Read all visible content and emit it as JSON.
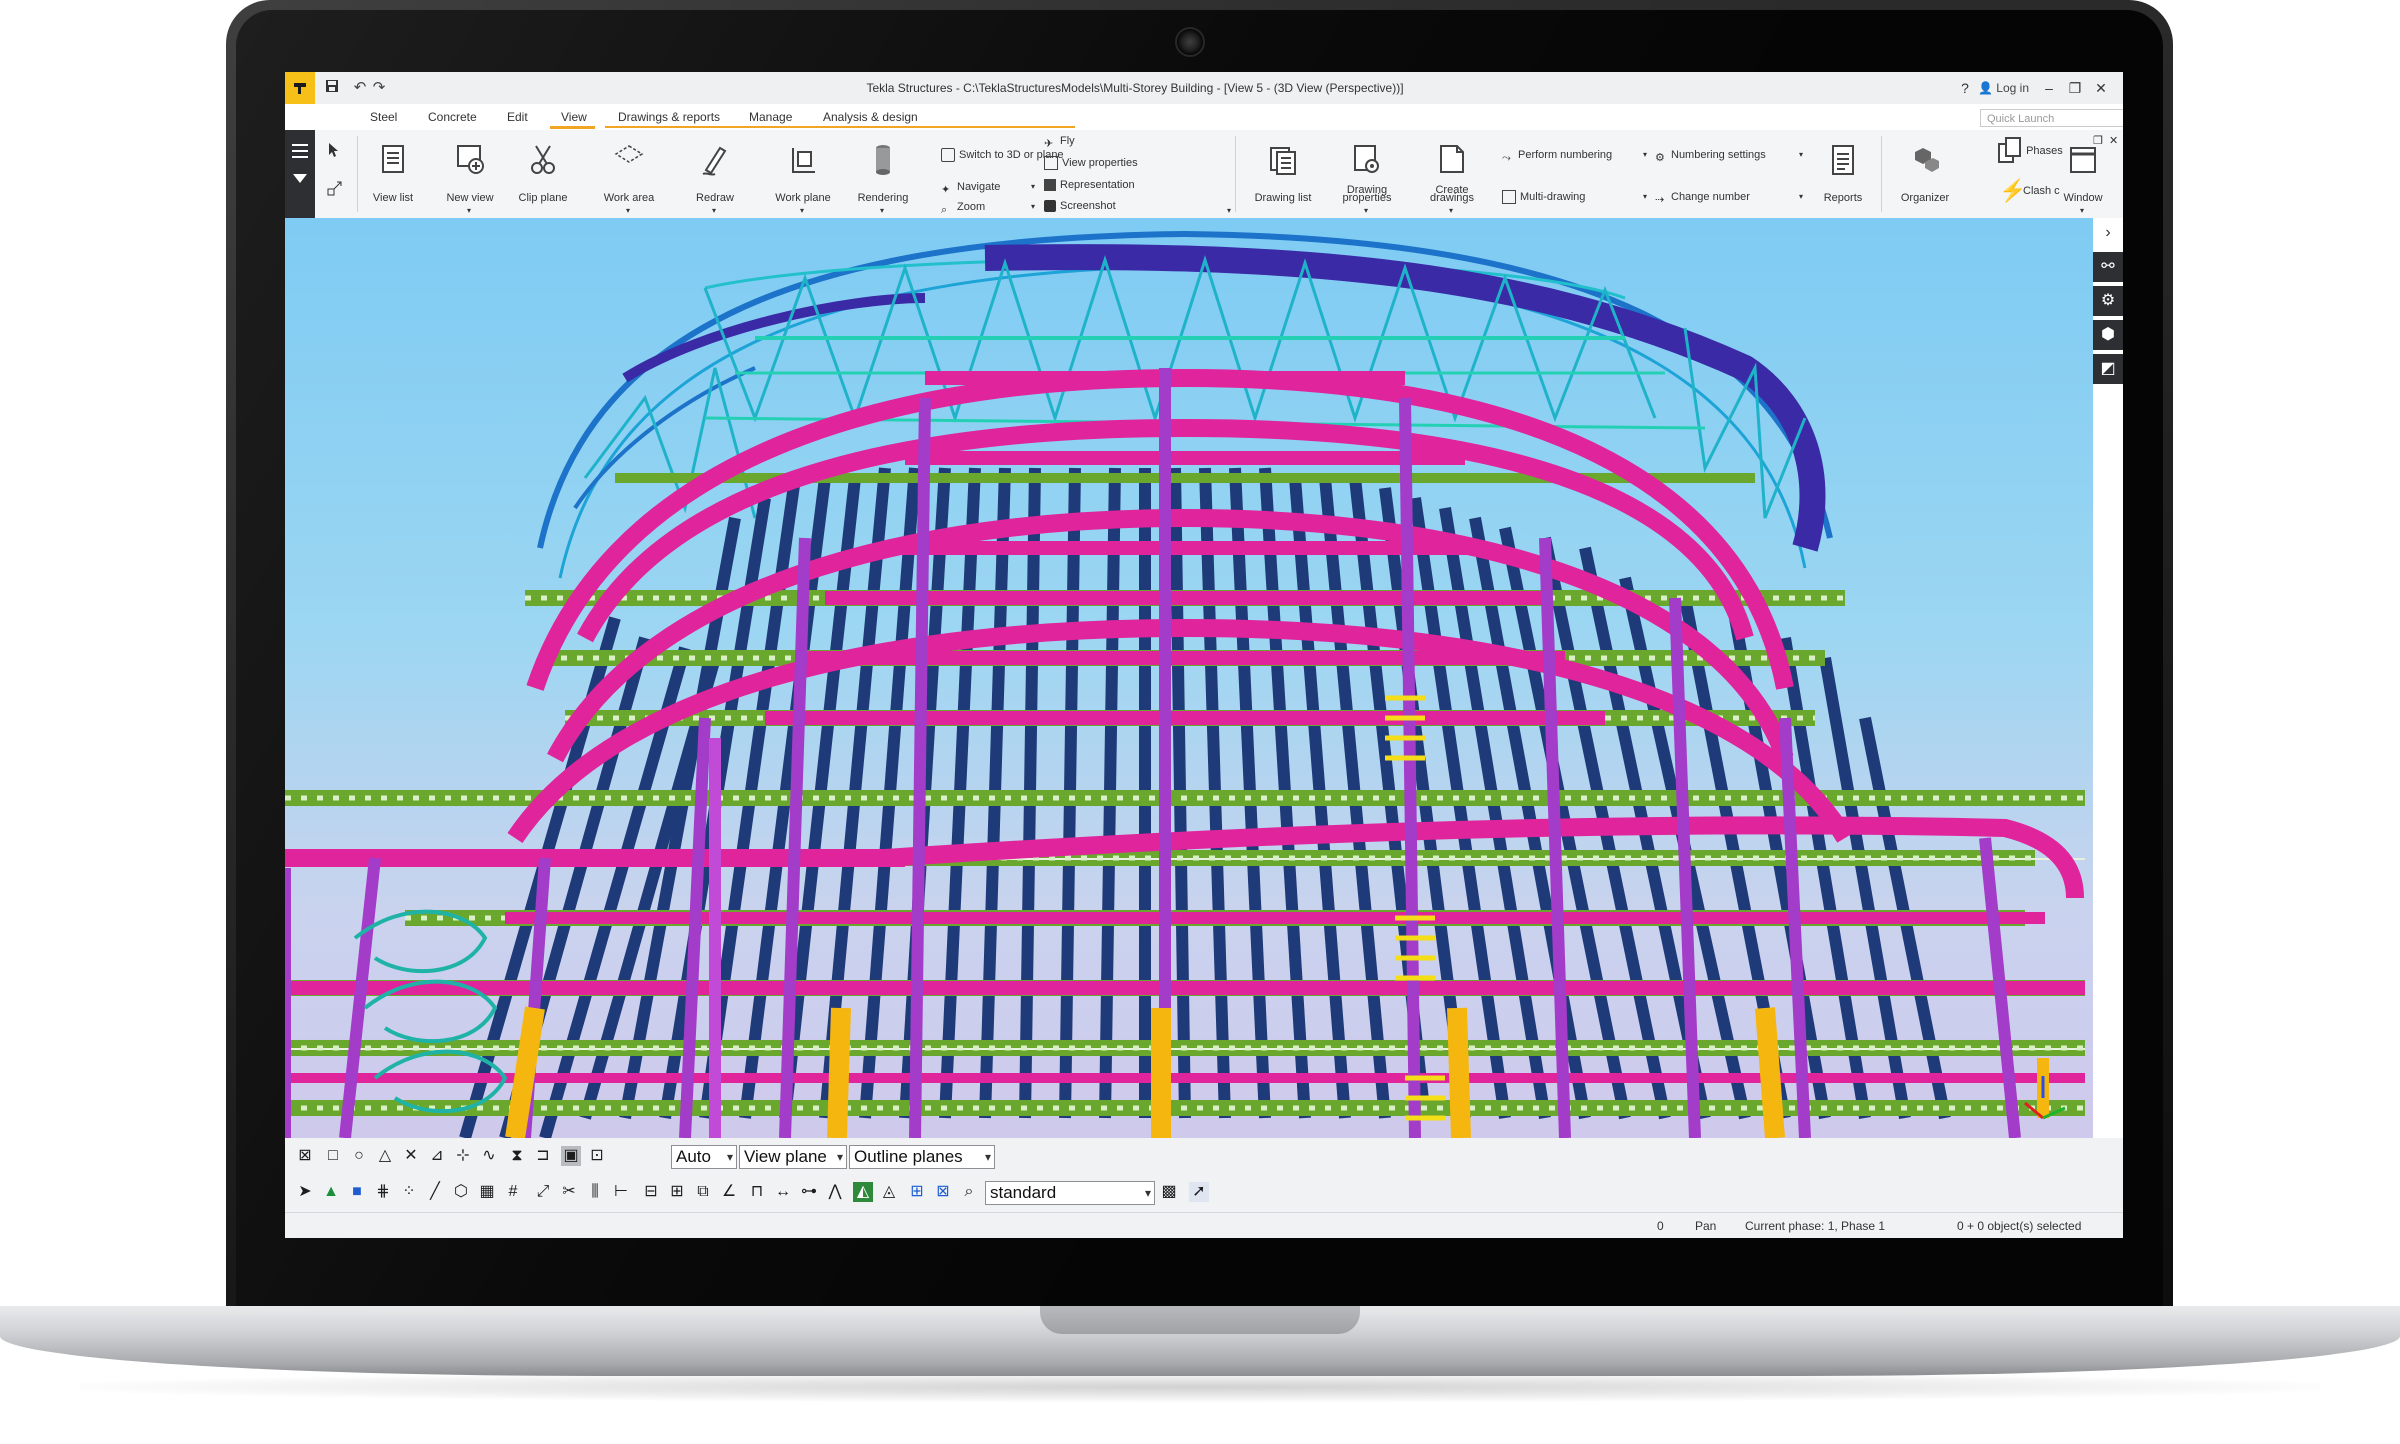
{
  "window": {
    "title": "Tekla Structures - C:\\TeklaStructuresModels\\Multi-Storey Building  - [View 5 - (3D View (Perspective))]",
    "help_label": "?",
    "login_label": "Log in",
    "minimize_label": "–",
    "restore_label": "❐",
    "close_label": "✕"
  },
  "tabs": [
    {
      "label": "Steel"
    },
    {
      "label": "Concrete"
    },
    {
      "label": "Edit"
    },
    {
      "label": "View"
    },
    {
      "label": "Drawings & reports"
    },
    {
      "label": "Manage"
    },
    {
      "label": "Analysis & design"
    }
  ],
  "active_tab": "View",
  "quick_launch": {
    "placeholder": "Quick Launch"
  },
  "ribbon": {
    "view_list": "View list",
    "new_view": "New view",
    "clip_plane": "Clip plane",
    "work_area": "Work area",
    "redraw": "Redraw",
    "work_plane": "Work plane",
    "rendering": "Rendering",
    "switch_3d": "Switch to 3D or plane",
    "navigate": "Navigate",
    "zoom": "Zoom",
    "fly": "Fly",
    "view_properties": "View properties",
    "representation": "Representation",
    "screenshot": "Screenshot",
    "drawing_list": "Drawing list",
    "drawing_properties_1": "Drawing",
    "drawing_properties_2": "properties",
    "create_drawings_1": "Create",
    "create_drawings_2": "drawings",
    "perform_numbering": "Perform numbering",
    "multi_drawing": "Multi-drawing",
    "numbering_settings": "Numbering settings",
    "change_number": "Change number",
    "reports": "Reports",
    "organizer": "Organizer",
    "phases": "Phases",
    "clash": "Clash c",
    "window": "Window"
  },
  "toolbar": {
    "snap_mode": "Auto",
    "plane_mode": "View plane",
    "plane_type": "Outline planes",
    "selection_filter": "standard"
  },
  "status": {
    "value": "0",
    "mode": "Pan",
    "phase": "Current phase: 1, Phase 1",
    "selection": "0 + 0 object(s) selected"
  },
  "colors": {
    "accent": "#f1a525",
    "app_logo": "#f6c018",
    "beam_magenta": "#e0249b",
    "beam_green": "#6aa72d",
    "beam_navy": "#1f3a78",
    "column_purple": "#a23cc9",
    "column_yellow": "#f5b70f",
    "ring_blue": "#3d2ea8",
    "truss_cyan": "#22b6c9"
  }
}
